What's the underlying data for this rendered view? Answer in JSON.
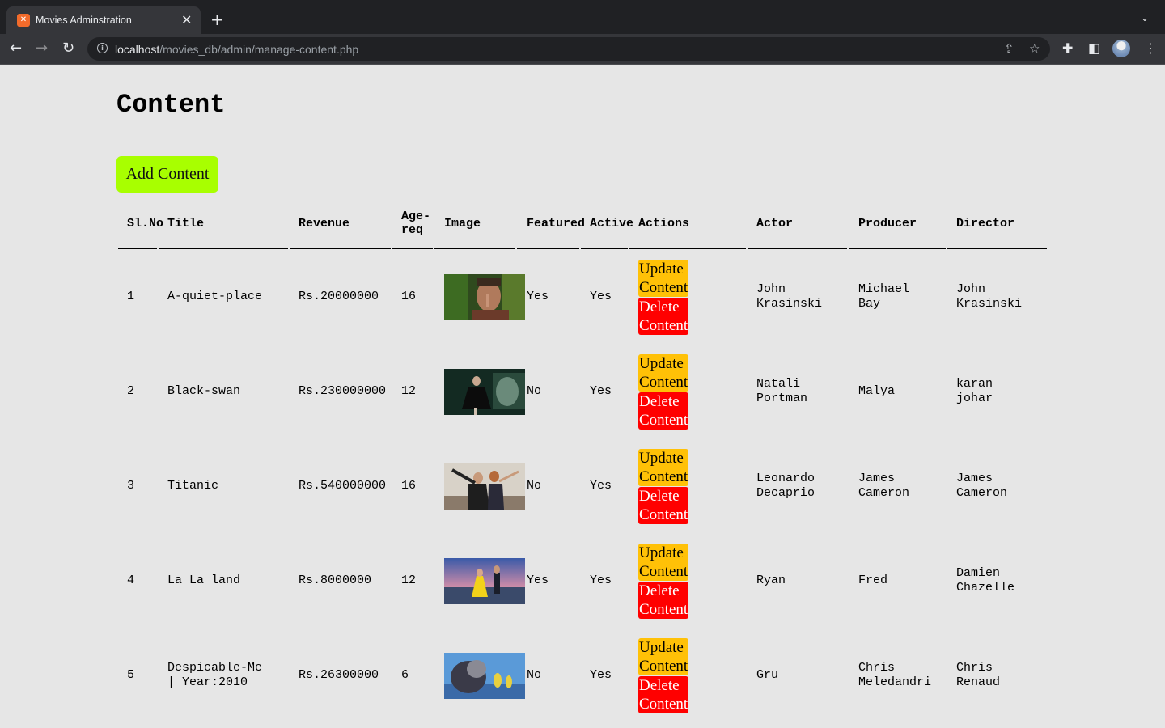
{
  "browser": {
    "tab_title": "Movies Adminstration",
    "url_host": "localhost",
    "url_path": "/movies_db/admin/manage-content.php"
  },
  "page": {
    "title": "Content",
    "add_button": "Add Content"
  },
  "table": {
    "headers": [
      "Sl.No",
      "Title",
      "Revenue",
      "Age-\nreq",
      "Image",
      "Featured",
      "Active",
      "Actions",
      "Actor",
      "Producer",
      "Director"
    ],
    "action_labels": {
      "update": "Update Content",
      "delete": "Delete Content",
      "update_l1": "Update",
      "update_l2": "Content",
      "delete_l1": "Delete",
      "delete_l2": "Content"
    },
    "rows": [
      {
        "sl": "1",
        "title": "A-quiet-place",
        "revenue": "Rs.20000000",
        "age": "16",
        "featured": "Yes",
        "active": "Yes",
        "actor": "John\nKrasinski",
        "producer": "Michael\nBay",
        "director": "John\nKrasinski",
        "image": "quiet-place-poster"
      },
      {
        "sl": "2",
        "title": "Black-swan",
        "revenue": "Rs.230000000",
        "age": "12",
        "featured": "No",
        "active": "Yes",
        "actor": "Natali\nPortman",
        "producer": "Malya",
        "director": "karan\njohar",
        "image": "black-swan-poster"
      },
      {
        "sl": "3",
        "title": "Titanic",
        "revenue": "Rs.540000000",
        "age": "16",
        "featured": "No",
        "active": "Yes",
        "actor": "Leonardo\nDecaprio",
        "producer": "James\nCameron",
        "director": "James\nCameron",
        "image": "titanic-poster"
      },
      {
        "sl": "4",
        "title": "La La land",
        "revenue": "Rs.8000000",
        "age": "12",
        "featured": "Yes",
        "active": "Yes",
        "actor": "Ryan",
        "producer": "Fred",
        "director": "Damien\nChazelle",
        "image": "la-la-land-poster"
      },
      {
        "sl": "5",
        "title": "Despicable-Me\n| Year:2010",
        "revenue": "Rs.26300000",
        "age": "6",
        "featured": "No",
        "active": "Yes",
        "actor": "Gru",
        "producer": "Chris\nMeledandri",
        "director": "Chris\nRenaud",
        "image": "despicable-me-poster"
      }
    ]
  },
  "colors": {
    "add_button": "#a8ff00",
    "update_button": "#ffc107",
    "delete_button": "#ff0000",
    "page_bg": "#e6e6e6"
  }
}
